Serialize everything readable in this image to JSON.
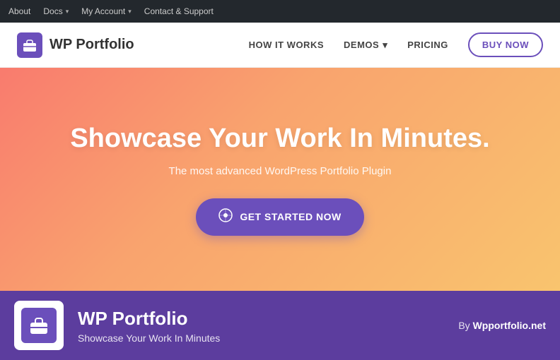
{
  "admin_bar": {
    "items": [
      {
        "label": "About",
        "has_arrow": false
      },
      {
        "label": "Docs",
        "has_arrow": true
      },
      {
        "label": "My Account",
        "has_arrow": true
      },
      {
        "label": "Contact & Support",
        "has_arrow": false
      }
    ]
  },
  "main_nav": {
    "logo_text": "WP Portfolio",
    "nav_links": [
      {
        "label": "HOW IT WORKS",
        "has_arrow": false
      },
      {
        "label": "DEMOS",
        "has_arrow": true
      },
      {
        "label": "PRICING",
        "has_arrow": false
      }
    ],
    "buy_now_label": "BUY NOW"
  },
  "hero": {
    "title": "Showcase Your Work In Minutes.",
    "subtitle": "The most advanced WordPress Portfolio Plugin",
    "cta_label": "GET STARTED NOW"
  },
  "info_bar": {
    "plugin_name": "WP Portfolio",
    "plugin_tagline": "Showcase Your Work In Minutes",
    "by_prefix": "By ",
    "by_link": "Wpportfolio.net"
  }
}
